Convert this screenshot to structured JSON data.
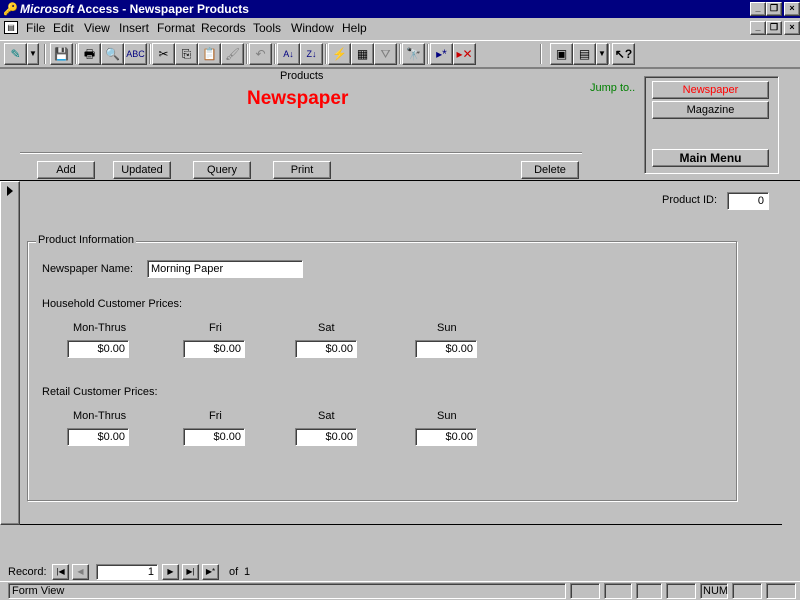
{
  "window": {
    "brand": "Microsoft",
    "title": " Access - Newspaper Products",
    "minimize": "_",
    "restore": "❐",
    "close": "×"
  },
  "menu": [
    "File",
    "Edit",
    "View",
    "Insert",
    "Format",
    "Records",
    "Tools",
    "Window",
    "Help"
  ],
  "form": {
    "header_label": "Products",
    "header_title": "Newspaper",
    "jump_label": "Jump to..",
    "jump_newspaper": "Newspaper",
    "jump_magazine": "Magazine",
    "main_menu": "Main Menu",
    "btn_add": "Add",
    "btn_updated": "Updated",
    "btn_query": "Query",
    "btn_print": "Print",
    "btn_delete": "Delete",
    "product_id_label": "Product ID:",
    "product_id_value": "0",
    "group_label": "Product Information",
    "name_label": "Newspaper Name:",
    "name_value": "Morning Paper",
    "household_label": "Household Customer Prices:",
    "retail_label": "Retail Customer Prices:",
    "days": [
      "Mon-Thrus",
      "Fri",
      "Sat",
      "Sun"
    ],
    "household_prices": [
      "$0.00",
      "$0.00",
      "$0.00",
      "$0.00"
    ],
    "retail_prices": [
      "$0.00",
      "$0.00",
      "$0.00",
      "$0.00"
    ]
  },
  "nav": {
    "record_label": "Record:",
    "record_value": "1",
    "of_label": "of",
    "total": "1"
  },
  "status": {
    "left": "Form View",
    "num": "NUM"
  },
  "colors": {
    "title_bar": "#000080",
    "header_red": "#ff0000",
    "jump_green": "#008000"
  }
}
